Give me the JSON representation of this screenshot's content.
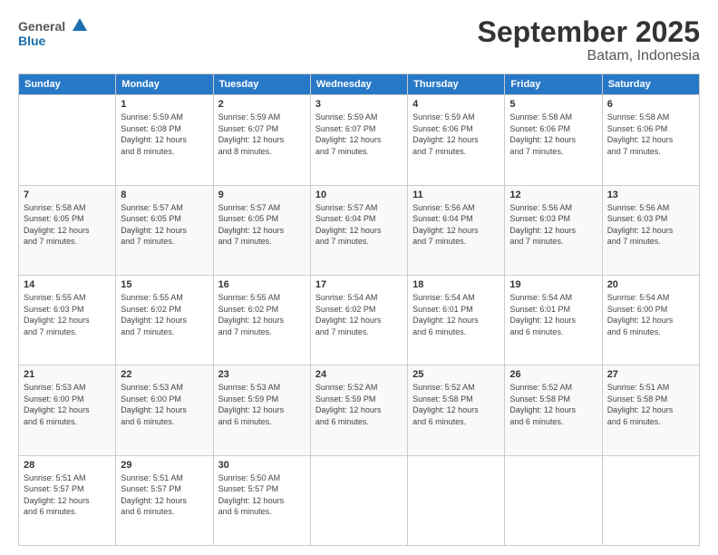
{
  "header": {
    "logo_general": "General",
    "logo_blue": "Blue",
    "title": "September 2025",
    "subtitle": "Batam, Indonesia"
  },
  "weekdays": [
    "Sunday",
    "Monday",
    "Tuesday",
    "Wednesday",
    "Thursday",
    "Friday",
    "Saturday"
  ],
  "weeks": [
    [
      {
        "day": "",
        "info": ""
      },
      {
        "day": "1",
        "info": "Sunrise: 5:59 AM\nSunset: 6:08 PM\nDaylight: 12 hours\nand 8 minutes."
      },
      {
        "day": "2",
        "info": "Sunrise: 5:59 AM\nSunset: 6:07 PM\nDaylight: 12 hours\nand 8 minutes."
      },
      {
        "day": "3",
        "info": "Sunrise: 5:59 AM\nSunset: 6:07 PM\nDaylight: 12 hours\nand 7 minutes."
      },
      {
        "day": "4",
        "info": "Sunrise: 5:59 AM\nSunset: 6:06 PM\nDaylight: 12 hours\nand 7 minutes."
      },
      {
        "day": "5",
        "info": "Sunrise: 5:58 AM\nSunset: 6:06 PM\nDaylight: 12 hours\nand 7 minutes."
      },
      {
        "day": "6",
        "info": "Sunrise: 5:58 AM\nSunset: 6:06 PM\nDaylight: 12 hours\nand 7 minutes."
      }
    ],
    [
      {
        "day": "7",
        "info": "Sunrise: 5:58 AM\nSunset: 6:05 PM\nDaylight: 12 hours\nand 7 minutes."
      },
      {
        "day": "8",
        "info": "Sunrise: 5:57 AM\nSunset: 6:05 PM\nDaylight: 12 hours\nand 7 minutes."
      },
      {
        "day": "9",
        "info": "Sunrise: 5:57 AM\nSunset: 6:05 PM\nDaylight: 12 hours\nand 7 minutes."
      },
      {
        "day": "10",
        "info": "Sunrise: 5:57 AM\nSunset: 6:04 PM\nDaylight: 12 hours\nand 7 minutes."
      },
      {
        "day": "11",
        "info": "Sunrise: 5:56 AM\nSunset: 6:04 PM\nDaylight: 12 hours\nand 7 minutes."
      },
      {
        "day": "12",
        "info": "Sunrise: 5:56 AM\nSunset: 6:03 PM\nDaylight: 12 hours\nand 7 minutes."
      },
      {
        "day": "13",
        "info": "Sunrise: 5:56 AM\nSunset: 6:03 PM\nDaylight: 12 hours\nand 7 minutes."
      }
    ],
    [
      {
        "day": "14",
        "info": "Sunrise: 5:55 AM\nSunset: 6:03 PM\nDaylight: 12 hours\nand 7 minutes."
      },
      {
        "day": "15",
        "info": "Sunrise: 5:55 AM\nSunset: 6:02 PM\nDaylight: 12 hours\nand 7 minutes."
      },
      {
        "day": "16",
        "info": "Sunrise: 5:55 AM\nSunset: 6:02 PM\nDaylight: 12 hours\nand 7 minutes."
      },
      {
        "day": "17",
        "info": "Sunrise: 5:54 AM\nSunset: 6:02 PM\nDaylight: 12 hours\nand 7 minutes."
      },
      {
        "day": "18",
        "info": "Sunrise: 5:54 AM\nSunset: 6:01 PM\nDaylight: 12 hours\nand 6 minutes."
      },
      {
        "day": "19",
        "info": "Sunrise: 5:54 AM\nSunset: 6:01 PM\nDaylight: 12 hours\nand 6 minutes."
      },
      {
        "day": "20",
        "info": "Sunrise: 5:54 AM\nSunset: 6:00 PM\nDaylight: 12 hours\nand 6 minutes."
      }
    ],
    [
      {
        "day": "21",
        "info": "Sunrise: 5:53 AM\nSunset: 6:00 PM\nDaylight: 12 hours\nand 6 minutes."
      },
      {
        "day": "22",
        "info": "Sunrise: 5:53 AM\nSunset: 6:00 PM\nDaylight: 12 hours\nand 6 minutes."
      },
      {
        "day": "23",
        "info": "Sunrise: 5:53 AM\nSunset: 5:59 PM\nDaylight: 12 hours\nand 6 minutes."
      },
      {
        "day": "24",
        "info": "Sunrise: 5:52 AM\nSunset: 5:59 PM\nDaylight: 12 hours\nand 6 minutes."
      },
      {
        "day": "25",
        "info": "Sunrise: 5:52 AM\nSunset: 5:58 PM\nDaylight: 12 hours\nand 6 minutes."
      },
      {
        "day": "26",
        "info": "Sunrise: 5:52 AM\nSunset: 5:58 PM\nDaylight: 12 hours\nand 6 minutes."
      },
      {
        "day": "27",
        "info": "Sunrise: 5:51 AM\nSunset: 5:58 PM\nDaylight: 12 hours\nand 6 minutes."
      }
    ],
    [
      {
        "day": "28",
        "info": "Sunrise: 5:51 AM\nSunset: 5:57 PM\nDaylight: 12 hours\nand 6 minutes."
      },
      {
        "day": "29",
        "info": "Sunrise: 5:51 AM\nSunset: 5:57 PM\nDaylight: 12 hours\nand 6 minutes."
      },
      {
        "day": "30",
        "info": "Sunrise: 5:50 AM\nSunset: 5:57 PM\nDaylight: 12 hours\nand 6 minutes."
      },
      {
        "day": "",
        "info": ""
      },
      {
        "day": "",
        "info": ""
      },
      {
        "day": "",
        "info": ""
      },
      {
        "day": "",
        "info": ""
      }
    ]
  ]
}
